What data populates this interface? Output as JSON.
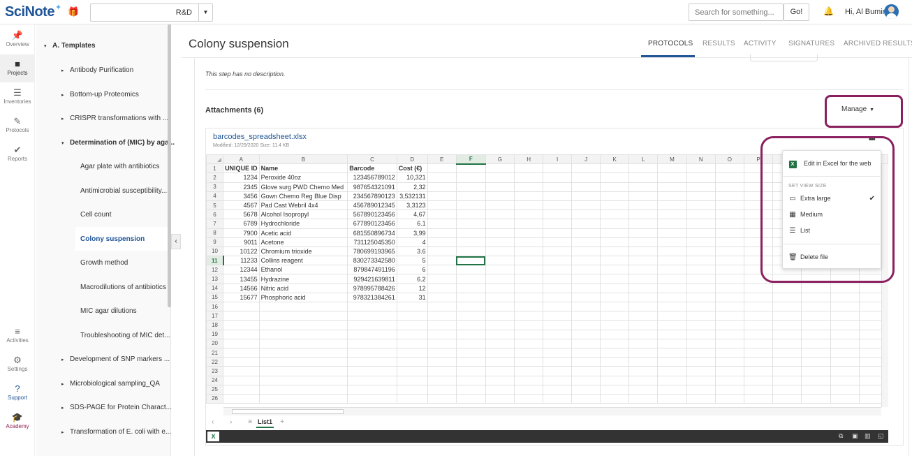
{
  "app": {
    "logo_text": "SciNote",
    "team": "R&D",
    "search_placeholder": "Search for something...",
    "go_label": "Go!",
    "greeting": "Hi, Al Bumin"
  },
  "leftnav": [
    {
      "name": "overview",
      "label": "Overview",
      "icon": "📌"
    },
    {
      "name": "projects",
      "label": "Projects",
      "icon": "■"
    },
    {
      "name": "inventories",
      "label": "Inventories",
      "icon": "☰"
    },
    {
      "name": "protocols",
      "label": "Protocols",
      "icon": "✎"
    },
    {
      "name": "reports",
      "label": "Reports",
      "icon": "✔"
    },
    {
      "name": "activities",
      "label": "Activities",
      "icon": "≡"
    },
    {
      "name": "settings",
      "label": "Settings",
      "icon": "⚙"
    },
    {
      "name": "support",
      "label": "Support",
      "icon": "?"
    },
    {
      "name": "academy",
      "label": "Academy",
      "icon": "🎓"
    }
  ],
  "tree": {
    "root": "A. Templates",
    "items": [
      {
        "label": "Antibody Purification",
        "level": 1,
        "arrow": "▸"
      },
      {
        "label": "Bottom-up Proteomics",
        "level": 1,
        "arrow": "▸"
      },
      {
        "label": "CRISPR transformations with ...",
        "level": 1,
        "arrow": "▸"
      },
      {
        "label": "Determination of (MIC) by aga...",
        "level": 1,
        "arrow": "▾",
        "bold": true
      },
      {
        "label": "Agar plate with antibiotics",
        "level": 2
      },
      {
        "label": "Antimicrobial susceptibility...",
        "level": 2
      },
      {
        "label": "Cell count",
        "level": 2
      },
      {
        "label": "Colony suspension",
        "level": 2,
        "active": true
      },
      {
        "label": "Growth method",
        "level": 2
      },
      {
        "label": "Macrodilutions of antibiotics",
        "level": 2
      },
      {
        "label": "MIC agar dilutions",
        "level": 2
      },
      {
        "label": "Troubleshooting of MIC det...",
        "level": 2
      },
      {
        "label": "Development of SNP markers ...",
        "level": 1,
        "arrow": "▸"
      },
      {
        "label": "Microbiological sampling_QA",
        "level": 1,
        "arrow": "▸"
      },
      {
        "label": "SDS-PAGE for Protein Charact...",
        "level": 1,
        "arrow": "▸"
      },
      {
        "label": "Transformation of E. coli with e...",
        "level": 1,
        "arrow": "▸"
      }
    ]
  },
  "main": {
    "title": "Colony suspension",
    "tabs": [
      "PROTOCOLS",
      "RESULTS",
      "ACTIVITY",
      "SIGNATURES",
      "ARCHIVED RESULTS"
    ],
    "no_description": "This step has no description.",
    "attachments_title": "Attachments (6)",
    "manage_label": "Manage"
  },
  "file": {
    "name": "barcodes_spreadsheet.xlsx",
    "meta": "Modified: 12/29/2020    Size: 11.4 KB"
  },
  "sheet": {
    "columns": [
      "A",
      "B",
      "C",
      "D",
      "E",
      "F",
      "G",
      "H",
      "I",
      "J",
      "K",
      "L",
      "M",
      "N",
      "O",
      "P",
      "Q",
      "R",
      "S",
      "T"
    ],
    "selected_column": "F",
    "selected_row": 11,
    "header": [
      "UNIQUE ID",
      "Name",
      "Barcode",
      "Cost (€)"
    ],
    "rows": [
      [
        "1234",
        "Peroxide 40oz",
        "123456789012",
        "10,321"
      ],
      [
        "2345",
        "Glove surg PWD Chemo Med",
        "987654321091",
        "2,32"
      ],
      [
        "3456",
        "Gown Chemo Reg Blue Disp",
        "234567890123",
        "3,532131"
      ],
      [
        "4567",
        "Pad Cast Webril 4x4",
        "456789012345",
        "3,3123"
      ],
      [
        "5678",
        "Alcohol Isopropyl",
        "567890123456",
        "4,67"
      ],
      [
        "6789",
        "Hydrochloride",
        "677890123456",
        "6.1"
      ],
      [
        "7900",
        "Acetic acid",
        "681550896734",
        "3,99"
      ],
      [
        "9011",
        "Acetone",
        "731125045350",
        "4"
      ],
      [
        "10122",
        "Chromium trioxide",
        "780699193965",
        "3.6"
      ],
      [
        "11233",
        "Collins reagent",
        "830273342580",
        "5"
      ],
      [
        "12344",
        "Ethanol",
        "879847491196",
        "6"
      ],
      [
        "13455",
        "Hydrazine",
        "929421639811",
        "6.2"
      ],
      [
        "14566",
        "Nitric acid",
        "978995788426",
        "12"
      ],
      [
        "15677",
        "Phosphoric acid",
        "978321384261",
        "31"
      ]
    ],
    "total_rows": 26,
    "tab_name": "List1"
  },
  "dropdown": {
    "edit_excel": "Edit in Excel for the web",
    "section_label": "SET VIEW SIZE",
    "extra_large": "Extra large",
    "medium": "Medium",
    "list": "List",
    "delete": "Delete file"
  },
  "colors": {
    "brand": "#1f5496",
    "highlight": "#8a2060",
    "excel_green": "#217346"
  }
}
